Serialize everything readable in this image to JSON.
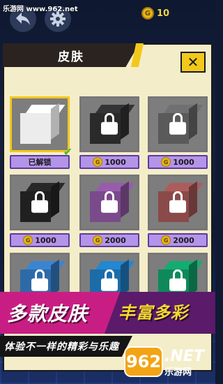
{
  "watermark": "乐游网 www.962.net",
  "top_bar": {
    "back_icon": "back-arrow-icon",
    "settings_icon": "gear-icon",
    "coins": "10",
    "coin_symbol": "G"
  },
  "panel": {
    "title": "皮肤",
    "close_label": "✕"
  },
  "skins": [
    {
      "status": "已解锁",
      "price": null,
      "locked": false,
      "selected": true,
      "color": "#ececec"
    },
    {
      "status": null,
      "price": "1000",
      "locked": true,
      "selected": false,
      "color": "#2a2a2a"
    },
    {
      "status": null,
      "price": "1000",
      "locked": true,
      "selected": false,
      "color": "#5a5a5a"
    },
    {
      "status": null,
      "price": "1000",
      "locked": true,
      "selected": false,
      "color": "#202020"
    },
    {
      "status": null,
      "price": "2000",
      "locked": true,
      "selected": false,
      "color": "#7a4a8a"
    },
    {
      "status": null,
      "price": "2000",
      "locked": true,
      "selected": false,
      "color": "#8a4a4a"
    },
    {
      "status": null,
      "price": null,
      "locked": true,
      "selected": false,
      "color": "#2e6aa8"
    },
    {
      "status": null,
      "price": null,
      "locked": true,
      "selected": false,
      "color": "#1c6ca8"
    },
    {
      "status": null,
      "price": null,
      "locked": true,
      "selected": false,
      "color": "#0e8a5a"
    }
  ],
  "banner": {
    "left_text": "多款皮肤",
    "right_text": "丰富多彩",
    "subtitle": "体验不一样的精彩与乐趣"
  },
  "logo": {
    "number": "962",
    "domain": ".NET",
    "name": "乐游网"
  },
  "colors": {
    "panel_bg": "#f4edc9",
    "accent_yellow": "#f2c81a",
    "price_purple": "#b494e8",
    "banner_pink": "#c81e84",
    "banner_purple": "#5b1a6a"
  }
}
